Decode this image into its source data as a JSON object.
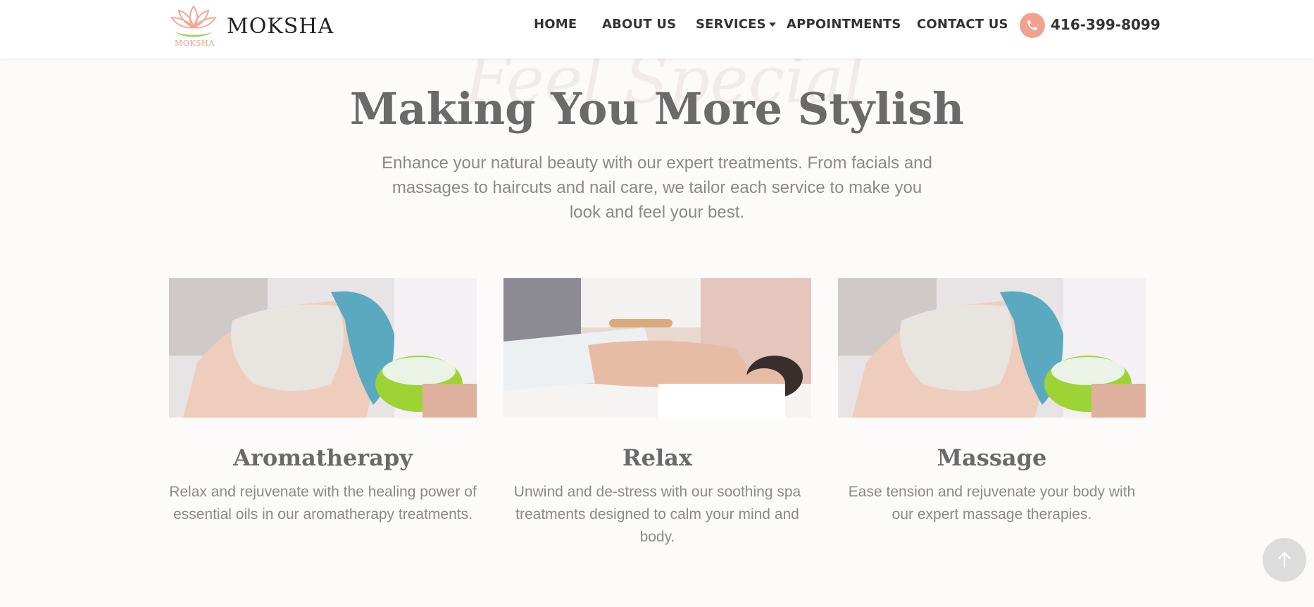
{
  "header": {
    "brand": "MOKSHA",
    "brand_mark_text": "MOKSHA",
    "nav": [
      {
        "label": "HOME"
      },
      {
        "label": "ABOUT US"
      },
      {
        "label": "SERVICES"
      },
      {
        "label": "APPOINTMENTS"
      },
      {
        "label": "CONTACT US"
      }
    ],
    "phone": "416-399-8099"
  },
  "hero": {
    "watermark": "Feel Special",
    "title": "Making You More Stylish",
    "description": "Enhance your natural beauty with our expert treatments. From facials and massages to haircuts and nail care, we tailor each service to make you look and feel your best."
  },
  "services": [
    {
      "title": "Aromatherapy",
      "text": "Relax and rejuvenate with the healing power of essential oils in our aromatherapy treatments.",
      "image": "facial-mask-photo"
    },
    {
      "title": "Relax",
      "text": "Unwind and de-stress with our soothing spa treatments designed to calm your mind and body.",
      "image": "back-massage-photo"
    },
    {
      "title": "Massage",
      "text": "Ease tension and rejuvenate your body with our expert massage therapies.",
      "image": "facial-mask-photo"
    }
  ],
  "colors": {
    "accent": "#f0a28f",
    "heading": "#6a6a6a",
    "body_text": "#8a8a8a",
    "background": "#fcfbfa"
  },
  "icons": {
    "phone": "phone-icon",
    "scroll_top": "arrow-up-icon",
    "dropdown": "caret-down-icon"
  }
}
